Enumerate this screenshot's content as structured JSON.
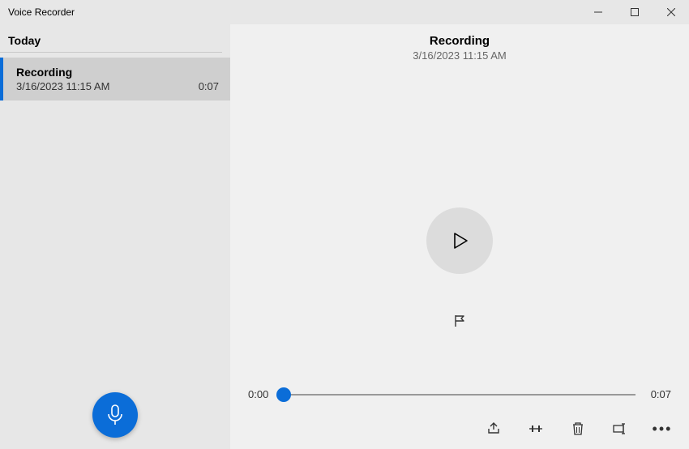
{
  "window": {
    "title": "Voice Recorder"
  },
  "sidebar": {
    "section_label": "Today",
    "items": [
      {
        "name": "Recording",
        "timestamp": "3/16/2023 11:15 AM",
        "duration": "0:07"
      }
    ]
  },
  "main": {
    "title": "Recording",
    "subtitle": "3/16/2023 11:15 AM",
    "current_time": "0:00",
    "total_time": "0:07"
  },
  "icons": {
    "record": "microphone-icon",
    "play": "play-icon",
    "flag": "flag-icon",
    "share": "share-icon",
    "trim": "trim-icon",
    "delete": "delete-icon",
    "rename": "rename-icon",
    "more": "more-icon"
  },
  "colors": {
    "accent": "#0b6dd8"
  }
}
